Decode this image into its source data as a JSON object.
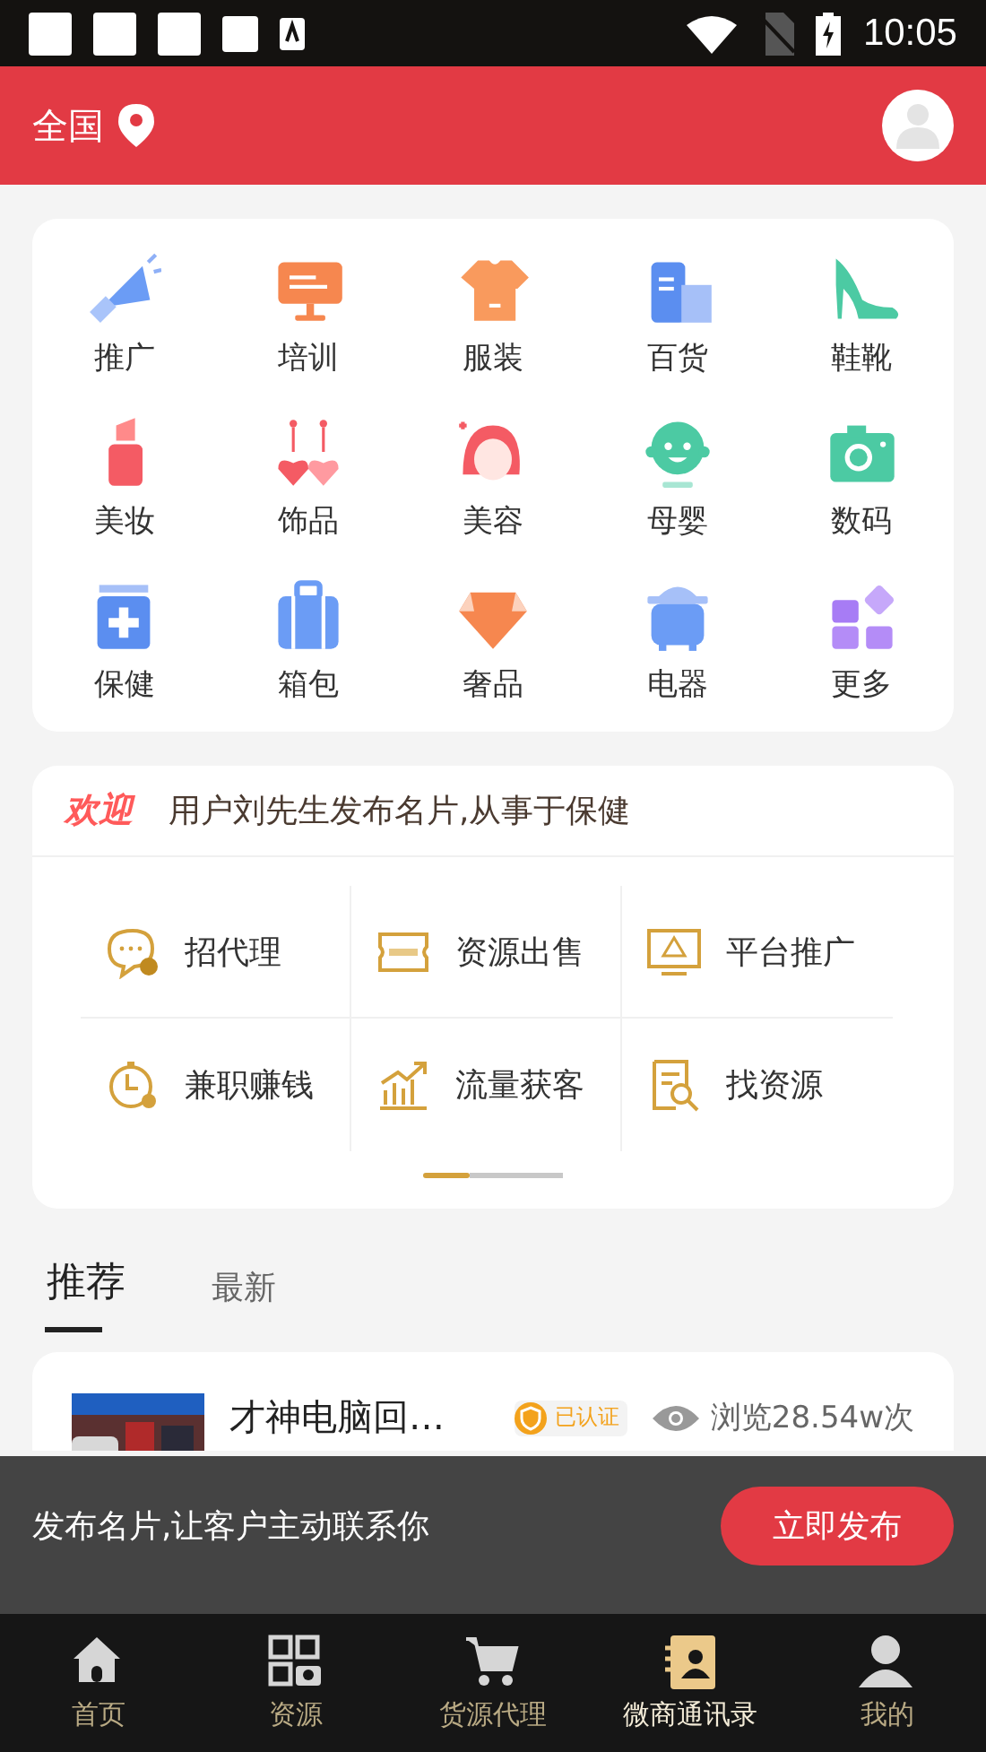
{
  "status_bar": {
    "time": "10:05"
  },
  "header": {
    "location": "全国"
  },
  "categories": [
    {
      "label": "推广"
    },
    {
      "label": "培训"
    },
    {
      "label": "服装"
    },
    {
      "label": "百货"
    },
    {
      "label": "鞋靴"
    },
    {
      "label": "美妆"
    },
    {
      "label": "饰品"
    },
    {
      "label": "美容"
    },
    {
      "label": "母婴"
    },
    {
      "label": "数码"
    },
    {
      "label": "保健"
    },
    {
      "label": "箱包"
    },
    {
      "label": "奢品"
    },
    {
      "label": "电器"
    },
    {
      "label": "更多"
    }
  ],
  "notice": {
    "badge": "欢迎",
    "message": "用户刘先生发布名片,从事于保健"
  },
  "features": [
    {
      "label": "招代理"
    },
    {
      "label": "资源出售"
    },
    {
      "label": "平台推广"
    },
    {
      "label": "兼职赚钱"
    },
    {
      "label": "流量获客"
    },
    {
      "label": "找资源"
    }
  ],
  "pager": [
    {
      "selected": true
    },
    {
      "selected": false
    },
    {
      "selected": false
    }
  ],
  "feed_tabs": [
    {
      "label": "推荐",
      "selected": true
    },
    {
      "label": "最新",
      "selected": false
    }
  ],
  "card": {
    "title": "才神电脑回…",
    "verified": "已认证",
    "views": "浏览28.54w次"
  },
  "banner": {
    "text": "发布名片,让客户主动联系你",
    "button": "立即发布"
  },
  "nav": [
    {
      "label": "首页",
      "selected": false
    },
    {
      "label": "资源",
      "selected": false
    },
    {
      "label": "货源代理",
      "selected": false
    },
    {
      "label": "微商通讯录",
      "selected": true
    },
    {
      "label": "我的",
      "selected": false
    }
  ]
}
